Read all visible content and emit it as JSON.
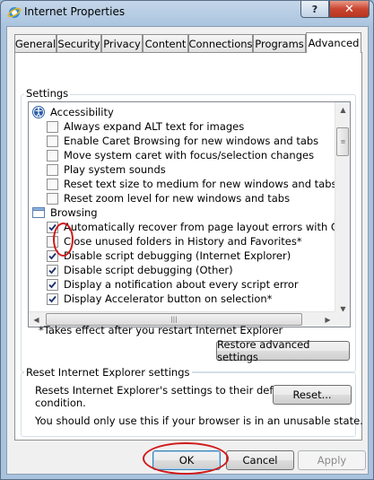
{
  "window": {
    "title": "Internet Properties",
    "help_label": "?",
    "close_label": "✕"
  },
  "tabs": [
    {
      "label": "General"
    },
    {
      "label": "Security"
    },
    {
      "label": "Privacy"
    },
    {
      "label": "Content"
    },
    {
      "label": "Connections"
    },
    {
      "label": "Programs"
    },
    {
      "label": "Advanced"
    }
  ],
  "active_tab": "Advanced",
  "settings": {
    "group_label": "Settings",
    "items": [
      {
        "type": "category",
        "label": "Accessibility",
        "icon": "accessibility-icon"
      },
      {
        "type": "checkbox",
        "label": "Always expand ALT text for images",
        "checked": false
      },
      {
        "type": "checkbox",
        "label": "Enable Caret Browsing for new windows and tabs",
        "checked": false
      },
      {
        "type": "checkbox",
        "label": "Move system caret with focus/selection changes",
        "checked": false
      },
      {
        "type": "checkbox",
        "label": "Play system sounds",
        "checked": false
      },
      {
        "type": "checkbox",
        "label": "Reset text size to medium for new windows and tabs",
        "checked": false
      },
      {
        "type": "checkbox",
        "label": "Reset zoom level for new windows and tabs",
        "checked": false
      },
      {
        "type": "category",
        "label": "Browsing",
        "icon": "browsing-icon"
      },
      {
        "type": "checkbox",
        "label": "Automatically recover from page layout errors with Compa",
        "checked": true
      },
      {
        "type": "checkbox",
        "label": "Close unused folders in History and Favorites*",
        "checked": false
      },
      {
        "type": "checkbox",
        "label": "Disable script debugging (Internet Explorer)",
        "checked": true
      },
      {
        "type": "checkbox",
        "label": "Disable script debugging (Other)",
        "checked": true
      },
      {
        "type": "checkbox",
        "label": "Display a notification about every script error",
        "checked": true
      },
      {
        "type": "checkbox",
        "label": "Display Accelerator button on selection*",
        "checked": true
      }
    ],
    "footnote": "*Takes effect after you restart Internet Explorer",
    "restore_label": "Restore advanced settings"
  },
  "reset": {
    "group_label": "Reset Internet Explorer settings",
    "description_line1": "Resets Internet Explorer's settings to their default",
    "description_line2": "condition.",
    "button_label": "Reset...",
    "warning": "You should only use this if your browser is in an unusable state."
  },
  "buttons": {
    "ok": "OK",
    "cancel": "Cancel",
    "apply": "Apply"
  },
  "colors": {
    "annotation": "#d01a1a",
    "check": "#1c2f6e"
  }
}
